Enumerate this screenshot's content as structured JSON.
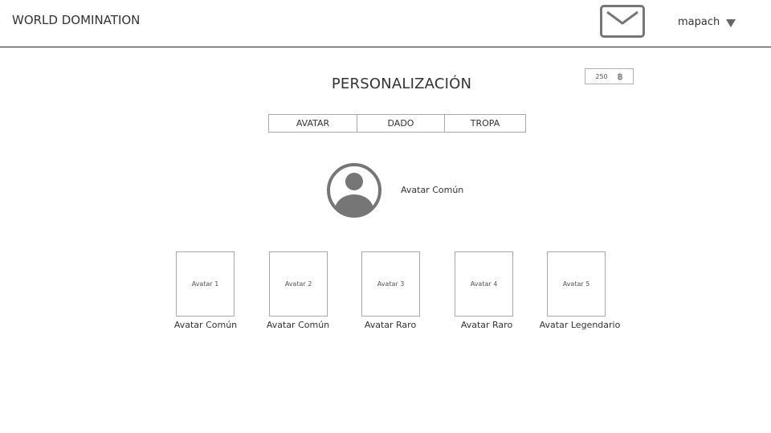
{
  "header": {
    "title": "WORLD DOMINATION",
    "username": "mapach"
  },
  "page": {
    "title": "PERSONALIZACIÓN",
    "coins": "250",
    "coin_symbol": "฿"
  },
  "tabs": [
    {
      "label": "AVATAR"
    },
    {
      "label": "DADO"
    },
    {
      "label": "TROPA"
    }
  ],
  "selected_avatar": {
    "label": "Avatar Común"
  },
  "avatars": [
    {
      "placeholder": "Avatar 1",
      "caption": "Avatar Común"
    },
    {
      "placeholder": "Avatar 2",
      "caption": "Avatar Común"
    },
    {
      "placeholder": "Avatar 3",
      "caption": "Avatar Raro"
    },
    {
      "placeholder": "Avatar 4",
      "caption": "Avatar Raro"
    },
    {
      "placeholder": "Avatar 5",
      "caption": "Avatar Legendario"
    }
  ]
}
